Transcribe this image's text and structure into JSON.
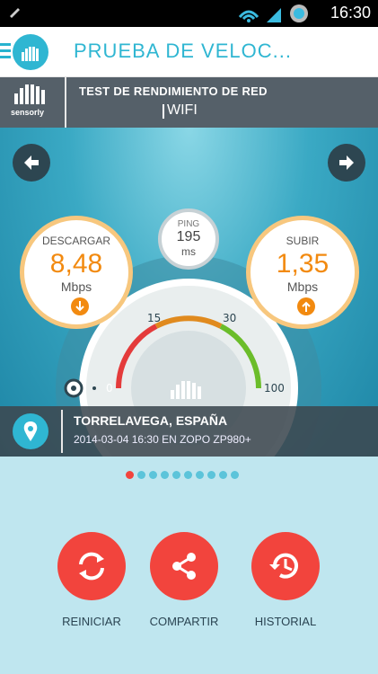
{
  "status_bar": {
    "time": "16:30",
    "icons": [
      "wifi-icon",
      "signal-icon",
      "battery-icon"
    ]
  },
  "app_bar": {
    "title": "PRUEBA DE VELOC..."
  },
  "test_header": {
    "brand": "sensorly",
    "title": "TEST DE RENDIMIENTO DE RED",
    "subtitle": "WIFI"
  },
  "results": {
    "download": {
      "label": "DESCARGAR",
      "value": "8,48",
      "unit": "Mbps"
    },
    "upload": {
      "label": "SUBIR",
      "value": "1,35",
      "unit": "Mbps"
    },
    "ping": {
      "label": "PING",
      "value": "195",
      "unit": "ms"
    }
  },
  "gauge": {
    "ticks": [
      "0",
      "15",
      "30",
      "100"
    ]
  },
  "location": {
    "city": "TORRELAVEGA, ESPAÑA",
    "meta": "2014-03-04 16:30 EN ZOPO ZP980+"
  },
  "pager": {
    "count": 10,
    "active": 0
  },
  "actions": {
    "restart": "REINICIAR",
    "share": "COMPARTIR",
    "history": "HISTORIAL"
  },
  "colors": {
    "accent": "#2fb6d2",
    "orange": "#f28a10",
    "red": "#f2443d",
    "dark": "#556069"
  }
}
